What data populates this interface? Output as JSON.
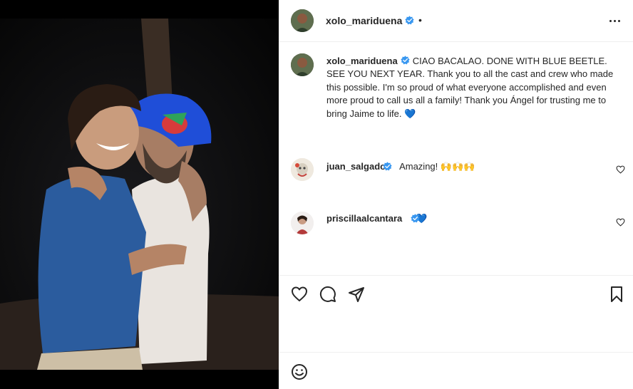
{
  "post": {
    "author": "xolo_mariduena",
    "header_dot": "•",
    "caption": "CIAO BACALAO. DONE WITH BLUE BEETLE. SEE YOU NEXT YEAR. Thank you to all the cast and crew who made this possible. I'm so proud of what everyone accomplished and even more proud to call us all a family! Thank you Ángel for trusting me to bring Jaime to life.",
    "caption_emoji": "💙"
  },
  "comments": [
    {
      "username": "juan_salgado",
      "text": "Amazing!",
      "emoji": "🙌🙌🙌"
    },
    {
      "username": "priscillaalcantara",
      "text": "",
      "emoji": "💙"
    }
  ],
  "icons": {
    "more": "more-options-icon",
    "like": "heart-icon",
    "comment": "comment-icon",
    "share": "paper-plane-icon",
    "save": "bookmark-icon",
    "emoji": "emoji-icon",
    "verified": "verified-badge-icon"
  },
  "colors": {
    "verified": "#3897f0",
    "heart_blue": "#5aa9e6",
    "text": "#262626",
    "divider": "#efefef"
  }
}
